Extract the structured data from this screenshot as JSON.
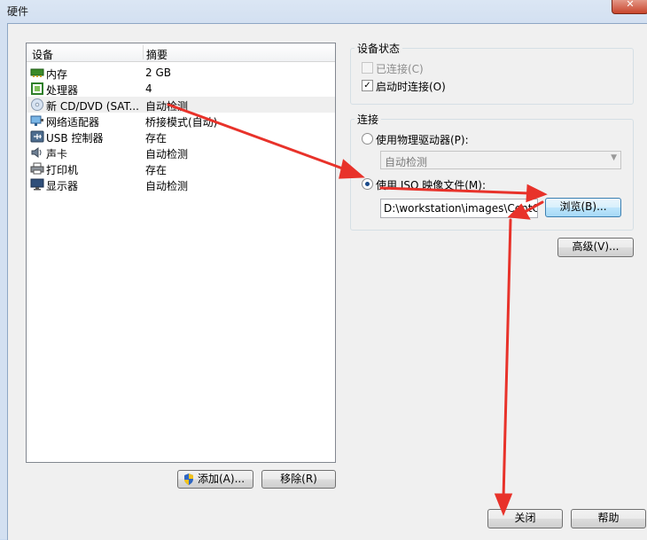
{
  "window": {
    "title": "硬件",
    "close": "✕"
  },
  "device_list": {
    "columns": [
      "设备",
      "摘要"
    ],
    "rows": [
      {
        "name": "内存",
        "summary": "2 GB",
        "icon": "memory-icon"
      },
      {
        "name": "处理器",
        "summary": "4",
        "icon": "processor-icon"
      },
      {
        "name": "新 CD/DVD (SAT...",
        "summary": "自动检测",
        "icon": "cd-dvd-icon"
      },
      {
        "name": "网络适配器",
        "summary": "桥接模式(自动)",
        "icon": "network-adapter-icon"
      },
      {
        "name": "USB 控制器",
        "summary": "存在",
        "icon": "usb-icon"
      },
      {
        "name": "声卡",
        "summary": "自动检测",
        "icon": "sound-card-icon"
      },
      {
        "name": "打印机",
        "summary": "存在",
        "icon": "printer-icon"
      },
      {
        "name": "显示器",
        "summary": "自动检测",
        "icon": "display-icon"
      }
    ]
  },
  "buttons": {
    "add": "添加(A)...",
    "remove": "移除(R)",
    "browse": "浏览(B)...",
    "advanced": "高级(V)...",
    "close": "关闭",
    "help": "帮助"
  },
  "device_status": {
    "title": "设备状态",
    "connected": "已连接(C)",
    "connect_on_power_on": "启动时连接(O)"
  },
  "connection": {
    "title": "连接",
    "physical_drive": "使用物理驱动器(P):",
    "physical_drive_value": "自动检测",
    "iso_image": "使用 ISO 映像文件(M):",
    "iso_path": "D:\\workstation\\images\\CentOS"
  },
  "colors": {
    "annotation_arrow": "#e8322a",
    "accent": "#3c7fb1"
  }
}
